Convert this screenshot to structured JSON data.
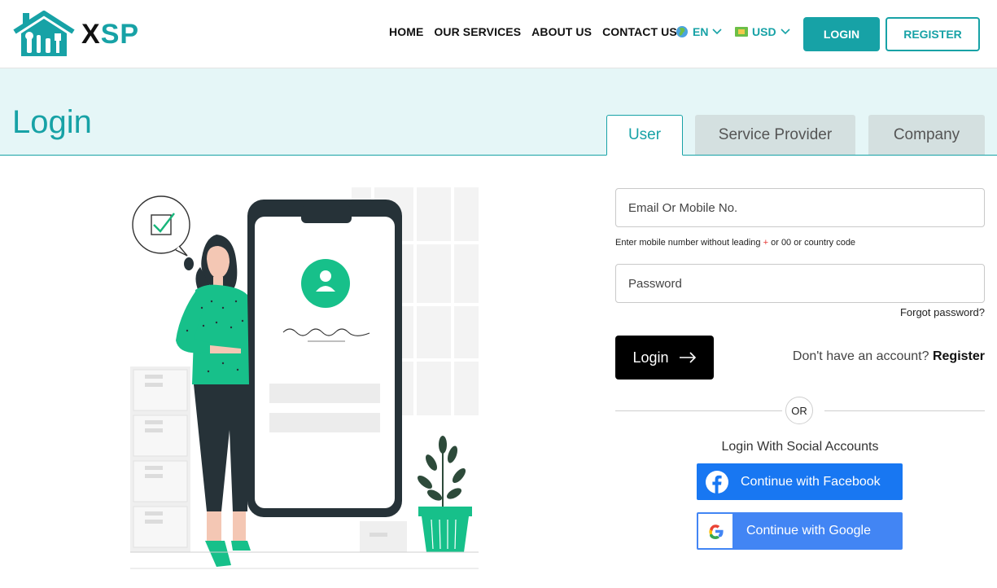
{
  "brand": {
    "name_part1": "X",
    "name_part2": "SP",
    "accent": "#17a2a6"
  },
  "nav": {
    "items": [
      "HOME",
      "OUR SERVICES",
      "ABOUT US",
      "CONTACT US"
    ],
    "language": "EN",
    "currency": "USD",
    "login_label": "LOGIN",
    "register_label": "REGISTER"
  },
  "page": {
    "title": "Login"
  },
  "tabs": [
    {
      "label": "User",
      "active": true
    },
    {
      "label": "Service Provider",
      "active": false
    },
    {
      "label": "Company",
      "active": false
    }
  ],
  "form": {
    "email_placeholder": "Email Or Mobile No.",
    "hint_before": "Enter mobile number without leading ",
    "hint_plus": "+",
    "hint_after": " or 00 or country code",
    "password_placeholder": "Password",
    "forgot": "Forgot password?",
    "submit_label": "Login",
    "no_account": "Don't have an account?",
    "register_link": "Register",
    "or": "OR",
    "social_title": "Login With Social Accounts",
    "facebook_label": "Continue with Facebook",
    "google_label": "Continue with Google"
  },
  "icons": {
    "globe": "globe-icon",
    "flag": "currency-flag-icon",
    "chevron": "chevron-down-icon",
    "arrow": "arrow-right-icon",
    "facebook": "facebook-icon",
    "google": "google-icon"
  }
}
